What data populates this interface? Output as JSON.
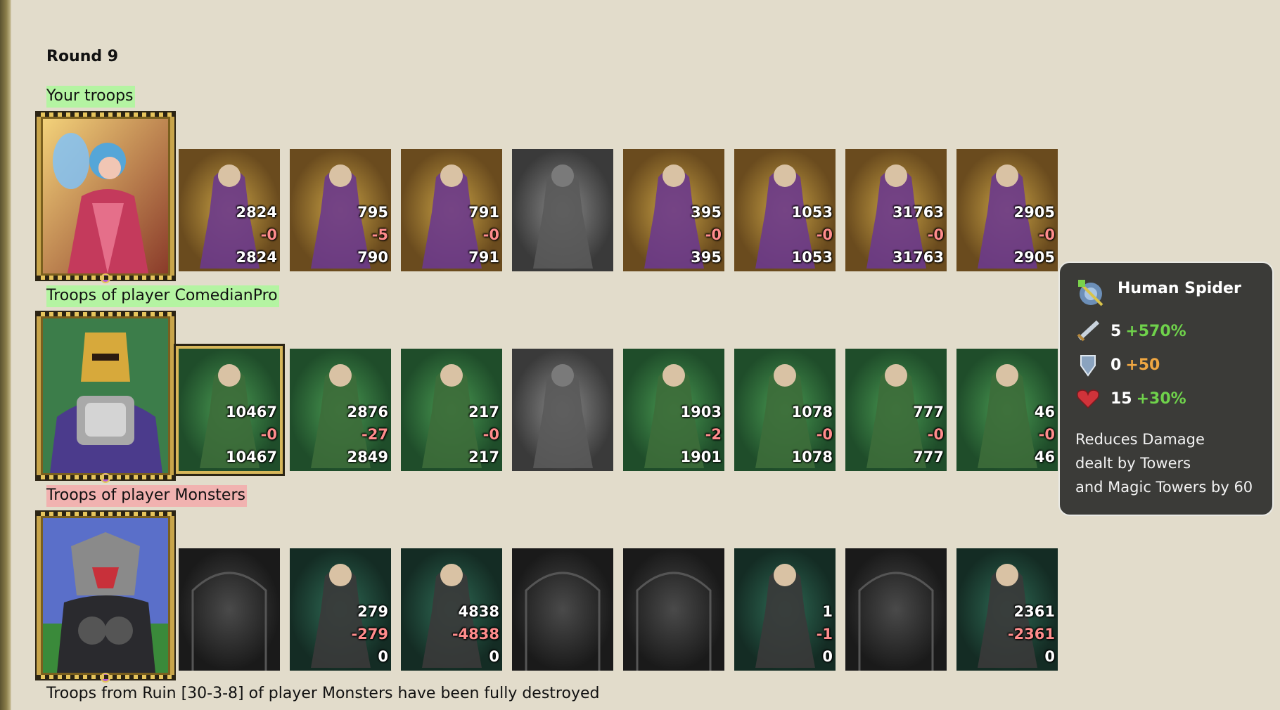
{
  "round": "Round 9",
  "sections": [
    {
      "label": "Your troops",
      "units": [
        {
          "total": "2824",
          "loss": "-0",
          "remain": "2824",
          "name": "golem"
        },
        {
          "total": "795",
          "loss": "-5",
          "remain": "790",
          "name": "assassin"
        },
        {
          "total": "791",
          "loss": "-0",
          "remain": "791",
          "name": "lizard-rider"
        },
        {
          "total": "",
          "loss": "",
          "remain": "",
          "name": "empty-gargoyle"
        },
        {
          "total": "395",
          "loss": "-0",
          "remain": "395",
          "name": "archer"
        },
        {
          "total": "1053",
          "loss": "-0",
          "remain": "1053",
          "name": "sorceress"
        },
        {
          "total": "31763",
          "loss": "-0",
          "remain": "31763",
          "name": "dark-warrior"
        },
        {
          "total": "2905",
          "loss": "-0",
          "remain": "2905",
          "name": "human-spider"
        }
      ]
    },
    {
      "label": "Troops of player ComedianPro",
      "units": [
        {
          "total": "10467",
          "loss": "-0",
          "remain": "10467",
          "name": "dwarf"
        },
        {
          "total": "2876",
          "loss": "-27",
          "remain": "2849",
          "name": "swordsman"
        },
        {
          "total": "217",
          "loss": "-0",
          "remain": "217",
          "name": "spearman"
        },
        {
          "total": "",
          "loss": "",
          "remain": "",
          "name": "empty-griffin"
        },
        {
          "total": "1903",
          "loss": "-2",
          "remain": "1901",
          "name": "elf-archer"
        },
        {
          "total": "1078",
          "loss": "-0",
          "remain": "1078",
          "name": "druid"
        },
        {
          "total": "777",
          "loss": "-0",
          "remain": "777",
          "name": "ranger"
        },
        {
          "total": "46",
          "loss": "-0",
          "remain": "46",
          "name": "shaman"
        }
      ]
    },
    {
      "label": "Troops of player Monsters",
      "units": [
        {
          "total": "",
          "loss": "",
          "remain": "",
          "name": "empty-1"
        },
        {
          "total": "279",
          "loss": "-279",
          "remain": "0",
          "name": "skeleton-brute"
        },
        {
          "total": "4838",
          "loss": "-4838",
          "remain": "0",
          "name": "orc-rider"
        },
        {
          "total": "",
          "loss": "",
          "remain": "",
          "name": "empty-2"
        },
        {
          "total": "",
          "loss": "",
          "remain": "",
          "name": "empty-3"
        },
        {
          "total": "1",
          "loss": "-1",
          "remain": "0",
          "name": "demon"
        },
        {
          "total": "",
          "loss": "",
          "remain": "",
          "name": "empty-4"
        },
        {
          "total": "2361",
          "loss": "-2361",
          "remain": "0",
          "name": "naga"
        }
      ]
    }
  ],
  "footer": "Troops from Ruin [30-3-8] of player Monsters have been fully destroyed",
  "tooltip": {
    "title": "Human Spider",
    "attack": {
      "base": "5",
      "bonus": "+570%"
    },
    "defense": {
      "base": "0",
      "bonus": "+50"
    },
    "health": {
      "base": "15",
      "bonus": "+30%"
    },
    "desc_lines": [
      "Reduces Damage",
      "dealt by Towers",
      "and Magic Towers by 60"
    ]
  },
  "colors": {
    "loss": "#ff8c8c",
    "label_green": "#b4f4a2",
    "label_red": "#f1b2b0",
    "bonus_green": "#6fd24b",
    "bonus_orange": "#f0a742"
  }
}
